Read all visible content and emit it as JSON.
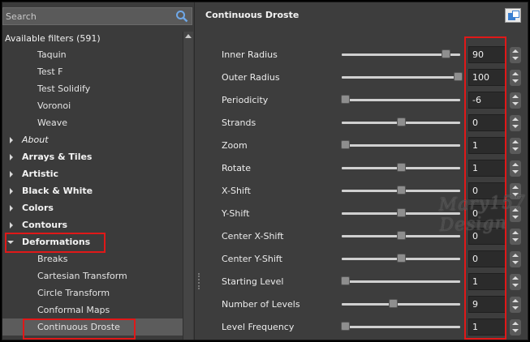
{
  "search": {
    "placeholder": "Search",
    "icon": "search-icon"
  },
  "filters": {
    "header": "Available filters (591)",
    "tree": [
      {
        "label": "Taquin",
        "kind": "item"
      },
      {
        "label": "Test F",
        "kind": "item"
      },
      {
        "label": "Test Solidify",
        "kind": "item"
      },
      {
        "label": "Voronoi",
        "kind": "item"
      },
      {
        "label": "Weave",
        "kind": "item"
      },
      {
        "label": "About",
        "kind": "cat",
        "italic": true
      },
      {
        "label": "Arrays & Tiles",
        "kind": "cat"
      },
      {
        "label": "Artistic",
        "kind": "cat"
      },
      {
        "label": "Black & White",
        "kind": "cat"
      },
      {
        "label": "Colors",
        "kind": "cat"
      },
      {
        "label": "Contours",
        "kind": "cat"
      },
      {
        "label": "Deformations",
        "kind": "cat",
        "open": true
      },
      {
        "label": "Breaks",
        "kind": "item"
      },
      {
        "label": "Cartesian Transform",
        "kind": "item"
      },
      {
        "label": "Circle Transform",
        "kind": "item"
      },
      {
        "label": "Conformal Maps",
        "kind": "item"
      },
      {
        "label": "Continuous Droste",
        "kind": "item",
        "selected": true
      }
    ]
  },
  "panel": {
    "title": "Continuous Droste",
    "parameters": [
      {
        "label": "Inner Radius",
        "value": "90",
        "slider": 0.88
      },
      {
        "label": "Outer Radius",
        "value": "100",
        "slider": 0.98
      },
      {
        "label": "Periodicity",
        "value": "-6",
        "slider": 0.03
      },
      {
        "label": "Strands",
        "value": "0",
        "slider": 0.5
      },
      {
        "label": "Zoom",
        "value": "1",
        "slider": 0.03
      },
      {
        "label": "Rotate",
        "value": "1",
        "slider": 0.5
      },
      {
        "label": "X-Shift",
        "value": "0",
        "slider": 0.5
      },
      {
        "label": "Y-Shift",
        "value": "0",
        "slider": 0.5
      },
      {
        "label": "Center X-Shift",
        "value": "0",
        "slider": 0.5
      },
      {
        "label": "Center Y-Shift",
        "value": "0",
        "slider": 0.5
      },
      {
        "label": "Starting Level",
        "value": "1",
        "slider": 0.03
      },
      {
        "label": "Number of Levels",
        "value": "9",
        "slider": 0.43
      },
      {
        "label": "Level Frequency",
        "value": "1",
        "slider": 0.03
      }
    ]
  },
  "watermark": "Mary157 Design",
  "colors": {
    "highlight_box": "#e01818",
    "background": "#3d3d3d",
    "selected_row": "#5c5c5c"
  }
}
